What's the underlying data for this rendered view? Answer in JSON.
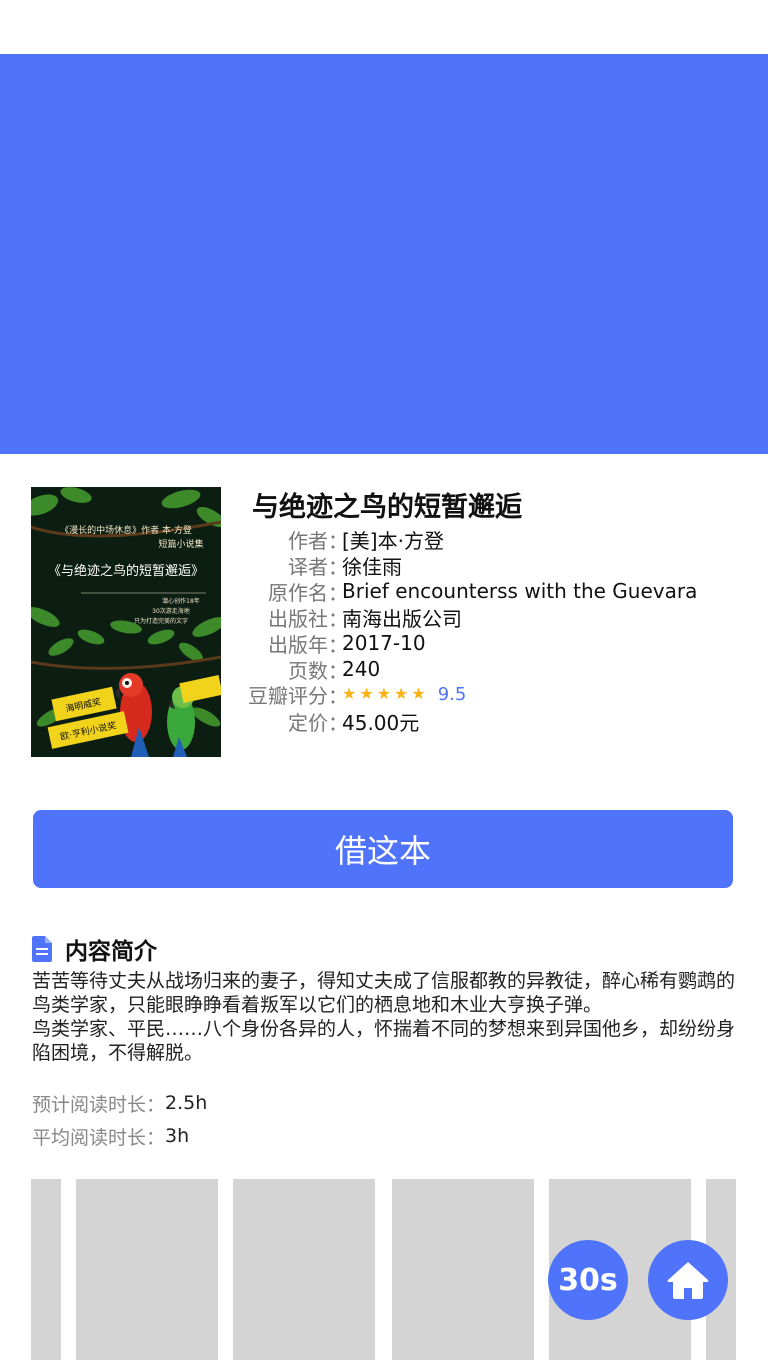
{
  "banner": {
    "color": "#4f74fb"
  },
  "book": {
    "title": "与绝迹之鸟的短暂邂逅",
    "cover": {
      "title_text": "《与绝迹之鸟的短暂邂逅》",
      "subtitle_text": "《漫长的中场休息》作者 本·方登",
      "series_text": "短篇小说集",
      "tagline_1": "潜心创作18年",
      "tagline_2": "30次游走海地",
      "tagline_3": "只为打造完美的文字",
      "badge_1": "海明威奖",
      "badge_2": "欧·亨利小说奖"
    },
    "meta": [
      {
        "label": "作者",
        "value": "[美]本·方登"
      },
      {
        "label": "译者",
        "value": "徐佳雨"
      },
      {
        "label": "原作名",
        "value": "Brief encounterss with the Guevara"
      },
      {
        "label": "出版社",
        "value": "南海出版公司"
      },
      {
        "label": "出版年",
        "value": "2017-10"
      },
      {
        "label": "页数",
        "value": "240"
      },
      {
        "label": "豆瓣评分",
        "value": "9.5",
        "stars": 5
      },
      {
        "label": "定价",
        "value": "45.00元"
      }
    ]
  },
  "actions": {
    "borrow_label": "借这本"
  },
  "summary": {
    "heading": "内容简介",
    "icon": "document-icon",
    "paragraphs": [
      "苦苦等待丈夫从战场归来的妻子，得知丈夫成了信服都教的异教徒，醉心稀有鹦鹉的鸟类学家，只能眼睁睁看着叛军以它们的栖息地和木业大亨换子弹。",
      "鸟类学家、平民……八个身份各异的人，怀揣着不同的梦想来到异国他乡，却纷纷身陷困境，不得解脱。"
    ]
  },
  "stats": {
    "estimated_label": "预计阅读时长：",
    "estimated_value": "2.5h",
    "average_label": "平均阅读时长：",
    "average_value": "3h"
  },
  "floating": {
    "timer_label": "30s",
    "home_icon": "home-icon"
  },
  "colors": {
    "accent": "#4f74fb",
    "star": "#f8b416",
    "placeholder": "#d4d4d4"
  }
}
